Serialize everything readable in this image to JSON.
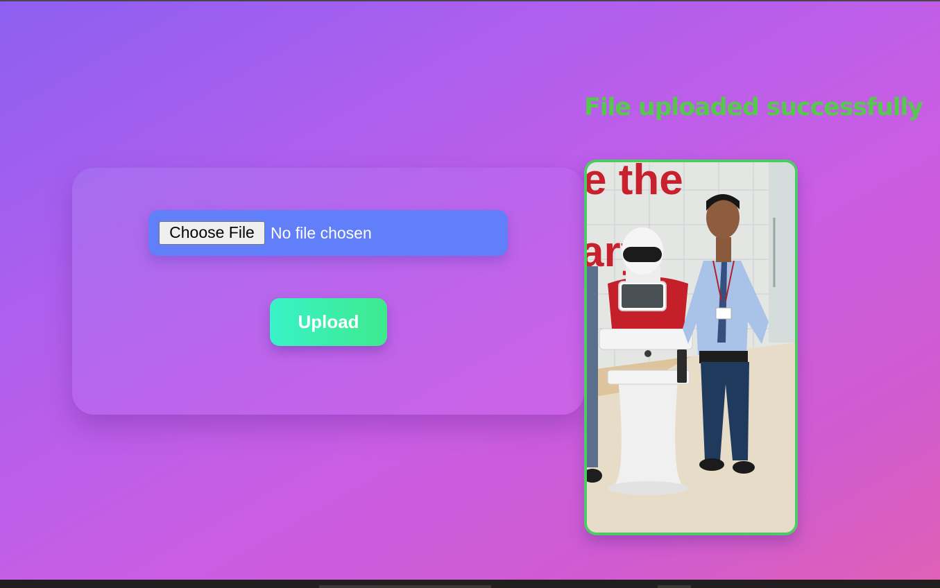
{
  "upload_form": {
    "choose_file_label": "Choose File",
    "no_file_text": "No file chosen",
    "upload_label": "Upload"
  },
  "status": {
    "message": "File uploaded successfully",
    "color": "#57c74f"
  },
  "preview": {
    "wall_text_top": "e the",
    "wall_text_side": "ary"
  },
  "colors": {
    "gradient_start": "#8d5ff0",
    "gradient_end": "#df60b6",
    "file_box": "#607ff8",
    "upload_start": "#38f3c7",
    "upload_end": "#3ee98d",
    "photo_border": "#4fc866"
  }
}
